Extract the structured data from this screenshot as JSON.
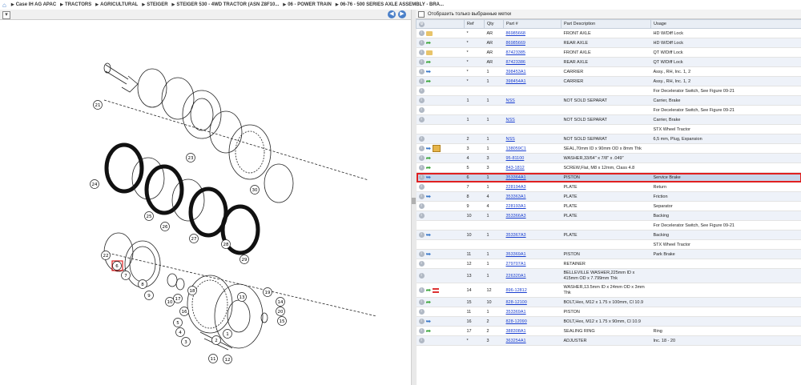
{
  "breadcrumb": [
    "Case IH AG APAC",
    "TRACTORS",
    "AGRICULTURAL",
    "STEIGER",
    "STEIGER 530 - 4WD TRACTOR (ASN Z8F10...",
    "06 - POWER TRAIN",
    "06-76 - 500 SERIES AXLE ASSEMBLY - BRA..."
  ],
  "filter": {
    "label": "Отобразить только выбранные метки"
  },
  "columns": [
    "Ref",
    "Qty",
    "Part #",
    "Part Description",
    "Usage"
  ],
  "callouts": [
    "1",
    "2",
    "3",
    "4",
    "5",
    "6",
    "7",
    "8",
    "9",
    "10",
    "11",
    "12",
    "13",
    "14",
    "15",
    "16",
    "17",
    "18",
    "19",
    "20",
    "21",
    "22",
    "23",
    "24",
    "25",
    "26",
    "27",
    "28",
    "29",
    "30"
  ],
  "rows": [
    {
      "icons": [
        "info",
        "folder"
      ],
      "ref": "*",
      "qty": "AR",
      "part": "86985668",
      "desc": "FRONT AXLE",
      "usage": "HD W/Diff Lock"
    },
    {
      "icons": [
        "info",
        "green-arrow"
      ],
      "ref": "*",
      "qty": "AR",
      "part": "86985669",
      "desc": "REAR AXLE",
      "usage": "HD W/Diff Lock"
    },
    {
      "icons": [
        "info",
        "folder"
      ],
      "ref": "*",
      "qty": "AR",
      "part": "87423385",
      "desc": "FRONT AXLE",
      "usage": "QT W/Diff Lock"
    },
    {
      "icons": [
        "info",
        "green-arrow"
      ],
      "ref": "*",
      "qty": "AR",
      "part": "87423386",
      "desc": "REAR AXLE",
      "usage": "QT W/Diff Lock"
    },
    {
      "icons": [
        "info",
        "blue-arrow"
      ],
      "ref": "*",
      "qty": "1",
      "part": "398453A1",
      "desc": "CARRIER",
      "usage": "Assy., RH, Inc. 1, 2"
    },
    {
      "icons": [
        "info",
        "green-arrow"
      ],
      "ref": "*",
      "qty": "1",
      "part": "398454A1",
      "desc": "CARRIER",
      "usage": "Assy., RH, Inc. 1, 2"
    },
    {
      "icons": [
        "info"
      ],
      "ref": "",
      "qty": "",
      "part": "",
      "desc": "",
      "usage": "For Decelerator Switch, See Figure 09-21"
    },
    {
      "icons": [
        "info"
      ],
      "ref": "1",
      "qty": "1",
      "part": "NSS",
      "desc": "NOT SOLD SEPARAT",
      "usage": "Carrier, Brake"
    },
    {
      "icons": [
        "info"
      ],
      "ref": "",
      "qty": "",
      "part": "",
      "desc": "",
      "usage": "For Decelerator Switch, See Figure 09-21"
    },
    {
      "icons": [
        "info"
      ],
      "ref": "1",
      "qty": "1",
      "part": "NSS",
      "desc": "NOT SOLD SEPARAT",
      "usage": "Carrier, Brake"
    },
    {
      "icons": [],
      "ref": "",
      "qty": "",
      "part": "",
      "desc": "",
      "usage": "STX Wheel Tractor"
    },
    {
      "icons": [
        "info"
      ],
      "ref": "2",
      "qty": "1",
      "part": "NSS",
      "desc": "NOT SOLD SEPARAT",
      "usage": "6,5 mm, Plug, Expansion"
    },
    {
      "icons": [
        "info",
        "blue-arrow",
        "box"
      ],
      "ref": "3",
      "qty": "1",
      "part": "138059C1",
      "desc": "SEAL,70mm ID x 90mm OD x 8mm Thk",
      "usage": ""
    },
    {
      "icons": [
        "info",
        "green-arrow"
      ],
      "ref": "4",
      "qty": "3",
      "part": "95-81100",
      "desc": "WASHER,33/64\" x 7/8\" x .049\"",
      "usage": ""
    },
    {
      "icons": [
        "info",
        "green-arrow"
      ],
      "ref": "5",
      "qty": "3",
      "part": "843-1812",
      "desc": "SCREW,Flat, M8 x 12mm, Class 4.8",
      "usage": ""
    },
    {
      "icons": [
        "info",
        "blue-arrow"
      ],
      "ref": "6",
      "qty": "1",
      "part": "353364A1",
      "desc": "PISTON",
      "usage": "Service Brake",
      "selected": true
    },
    {
      "icons": [
        "info"
      ],
      "ref": "7",
      "qty": "1",
      "part": "228194A3",
      "desc": "PLATE",
      "usage": "Return"
    },
    {
      "icons": [
        "info",
        "blue-arrow"
      ],
      "ref": "8",
      "qty": "4",
      "part": "353363A1",
      "desc": "PLATE",
      "usage": "Friction"
    },
    {
      "icons": [
        "info"
      ],
      "ref": "9",
      "qty": "4",
      "part": "228193A1",
      "desc": "PLATE",
      "usage": "Separator"
    },
    {
      "icons": [
        "info"
      ],
      "ref": "10",
      "qty": "1",
      "part": "353366A3",
      "desc": "PLATE",
      "usage": "Backing"
    },
    {
      "icons": [],
      "ref": "",
      "qty": "",
      "part": "",
      "desc": "",
      "usage": "For Decelerator Switch, See Figure 09-21"
    },
    {
      "icons": [
        "info",
        "blue-arrow"
      ],
      "ref": "10",
      "qty": "1",
      "part": "353367A3",
      "desc": "PLATE",
      "usage": "Backing"
    },
    {
      "icons": [],
      "ref": "",
      "qty": "",
      "part": "",
      "desc": "",
      "usage": "STX Wheel Tractor"
    },
    {
      "icons": [
        "info",
        "blue-arrow"
      ],
      "ref": "11",
      "qty": "1",
      "part": "353369A1",
      "desc": "PISTON",
      "usage": "Park Brake"
    },
    {
      "icons": [
        "info"
      ],
      "ref": "12",
      "qty": "1",
      "part": "279707A1",
      "desc": "RETAINER",
      "usage": ""
    },
    {
      "icons": [
        "info"
      ],
      "ref": "13",
      "qty": "1",
      "part": "226320A1",
      "desc": "BELLEVILLE WASHER,225mm ID x 415mm OD x 7.799mm Thk",
      "usage": "",
      "tall": true
    },
    {
      "icons": [
        "info",
        "green-arrow",
        "flag"
      ],
      "ref": "14",
      "qty": "12",
      "part": "896-12812",
      "desc": "WASHER,13.5mm ID x 24mm OD x 3mm Thk",
      "usage": "",
      "tall": true
    },
    {
      "icons": [
        "info",
        "green-arrow"
      ],
      "ref": "15",
      "qty": "10",
      "part": "828-12100",
      "desc": "BOLT,Hex, M12 x 1.75 x 100mm, Cl 10.9",
      "usage": ""
    },
    {
      "icons": [
        "info"
      ],
      "ref": "11",
      "qty": "1",
      "part": "353369A1",
      "desc": "PISTON",
      "usage": ""
    },
    {
      "icons": [
        "info",
        "blue-arrow"
      ],
      "ref": "16",
      "qty": "2",
      "part": "828-12090",
      "desc": "BOLT,Hex, M12 x 1.75 x 90mm, Cl 10.9",
      "usage": ""
    },
    {
      "icons": [
        "info",
        "green-arrow"
      ],
      "ref": "17",
      "qty": "2",
      "part": "388308A1",
      "desc": "SEALING RING",
      "usage": "Ring"
    },
    {
      "icons": [
        "info"
      ],
      "ref": "*",
      "qty": "3",
      "part": "363254A1",
      "desc": "ADJUSTER",
      "usage": "Inc. 18 - 20"
    }
  ]
}
